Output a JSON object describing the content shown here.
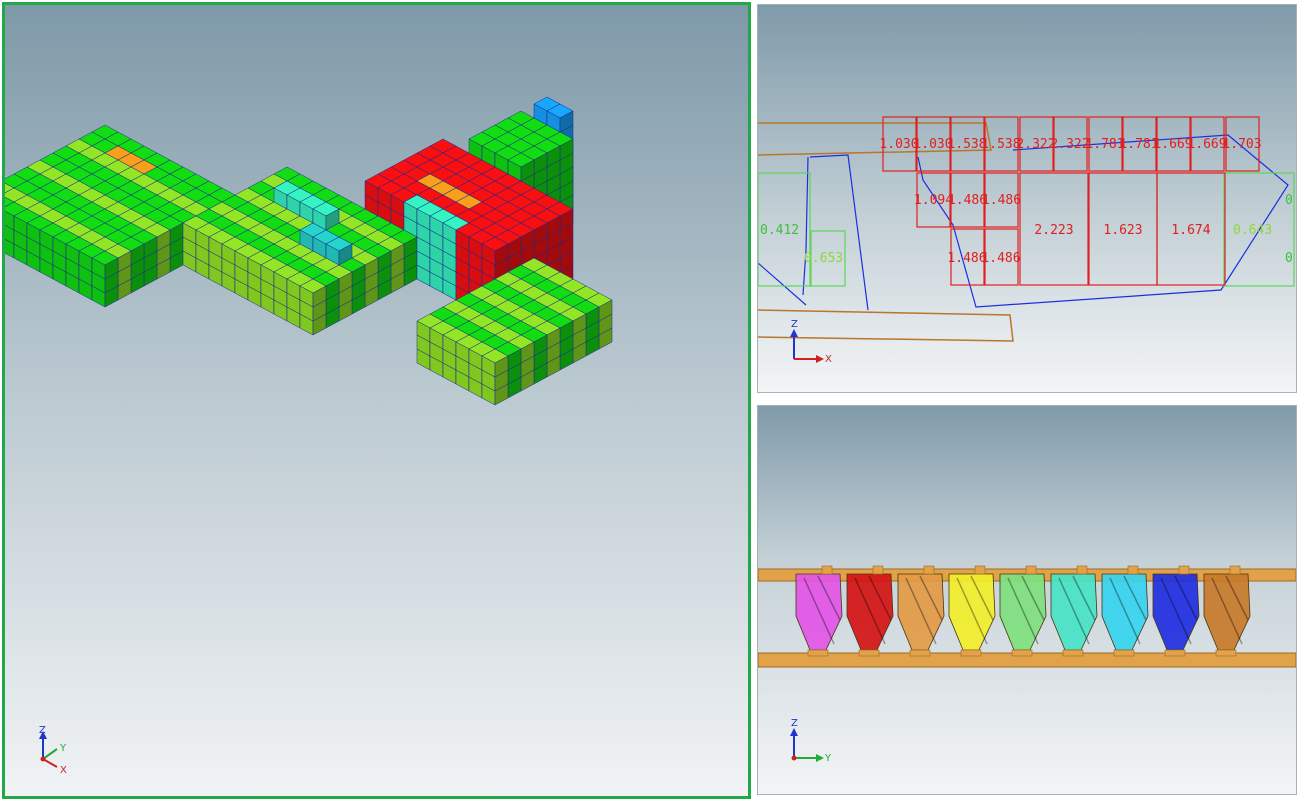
{
  "viewports": {
    "main": {
      "axes": {
        "z": "Z",
        "y": "Y",
        "x": "X"
      }
    },
    "top": {
      "axes": {
        "z": "Z",
        "x": "X"
      },
      "labels": {
        "row1": [
          "1.030",
          "1.030",
          "1.538",
          "1.538",
          "2.322",
          "2.322",
          "1.781",
          "1.781",
          "1.669",
          "1.669",
          "1.703"
        ],
        "row2": [
          "1.094",
          "1.486",
          "1.486",
          "2.223",
          "1.623",
          "1.674"
        ],
        "row3": [
          "1.486",
          "1.486"
        ],
        "left_value": "0.412",
        "green_small": "0.653",
        "green_right": "0.643",
        "edge_right_1": "0",
        "edge_right_2": "0"
      },
      "colors": {
        "red": "#e02020",
        "green": "#5dd55d",
        "blue": "#1a2fe0",
        "brown": "#b8762e"
      }
    },
    "bottom": {
      "axes": {
        "z": "Z",
        "y": "Y"
      },
      "hoppers": [
        "#e255e6",
        "#d41414",
        "#e39a45",
        "#f2ef2a",
        "#7ee07e",
        "#46e3c6",
        "#36d4ef",
        "#1f2ee0",
        "#c8792a"
      ]
    }
  }
}
